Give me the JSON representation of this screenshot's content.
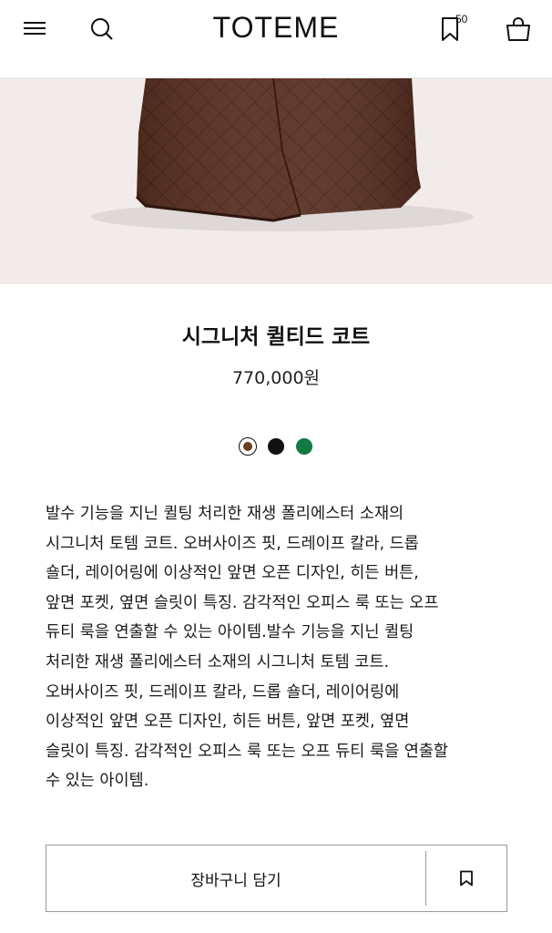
{
  "header": {
    "brand": "TOTEME",
    "wishlist_count": "50",
    "icons": [
      "menu-icon",
      "search-icon",
      "bookmark-icon",
      "shopping-bag-icon"
    ]
  },
  "product": {
    "title": "시그니처 퀼티드 코트",
    "price": "770,000원",
    "image_color": "#5a2f22",
    "background_color": "#f1ebea",
    "swatches": [
      {
        "color": "#6b3f22",
        "selected": true
      },
      {
        "color": "#111111",
        "selected": false
      },
      {
        "color": "#127a43",
        "selected": false
      }
    ],
    "description_lines": [
      "발수 기능을 지닌 퀼팅 처리한 재생 폴리에스터 소재의",
      "시그니처 토템 코트. 오버사이즈 핏, 드레이프 칼라, 드롭",
      "숄더, 레이어링에 이상적인 앞면 오픈 디자인, 히든 버튼,",
      "앞면 포켓, 옆면 슬릿이 특징. 감각적인 오피스 룩 또는 오프",
      "듀티 룩을 연출할 수 있는 아이템.발수 기능을 지닌 퀼팅",
      "처리한 재생 폴리에스터 소재의 시그니처 토템 코트.",
      "오버사이즈 핏, 드레이프 칼라, 드롭 숄더, 레이어링에",
      "이상적인 앞면 오픈 디자인, 히든 버튼, 앞면 포켓, 옆면",
      "슬릿이 특징. 감각적인 오피스 룩 또는 오프 듀티 룩을 연출할",
      "수 있는 아이템."
    ]
  },
  "actions": {
    "add_to_cart_label": "장바구니 담기"
  }
}
